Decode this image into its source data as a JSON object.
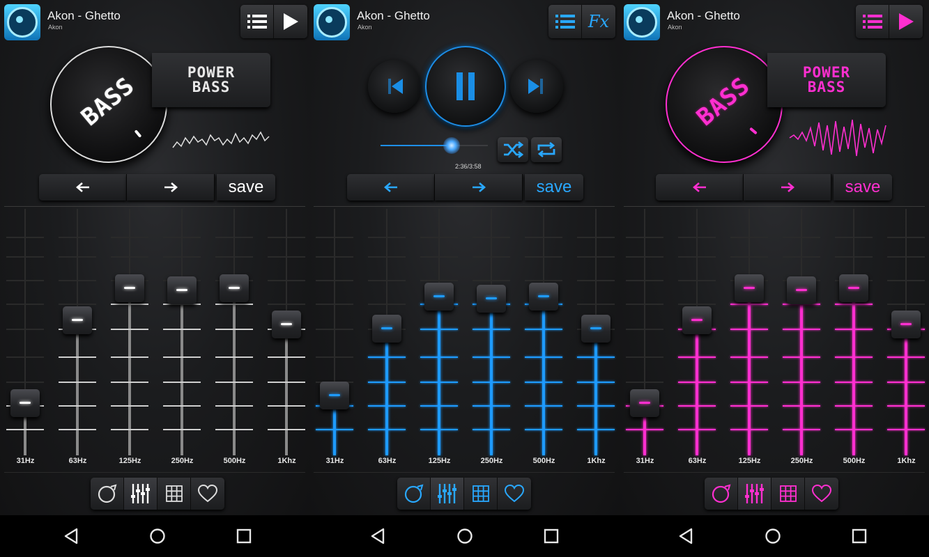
{
  "screens": [
    {
      "theme": "white",
      "accent": "#ffffff",
      "title": "Akon - Ghetto",
      "artist": "Akon",
      "header_buttons": [
        "list-icon",
        "play-icon"
      ],
      "knob_label": "BASS",
      "power_bass": [
        "POWER",
        "BASS"
      ],
      "save_label": "save",
      "bands": [
        {
          "label": "31Hz",
          "level": 0.23
        },
        {
          "label": "63Hz",
          "level": 0.64
        },
        {
          "label": "125Hz",
          "level": 0.8
        },
        {
          "label": "250Hz",
          "level": 0.79
        },
        {
          "label": "500Hz",
          "level": 0.8
        },
        {
          "label": "1Khz",
          "level": 0.62
        }
      ],
      "active_tab": 1
    },
    {
      "theme": "blue",
      "accent": "#1e9bff",
      "title": "Akon - Ghetto",
      "artist": "Akon",
      "header_buttons": [
        "list-icon",
        "fx-icon"
      ],
      "fx_label": "Fx",
      "seek_progress": 0.66,
      "time": "2:36/3:58",
      "save_label": "save",
      "bands": [
        {
          "label": "31Hz",
          "level": 0.27
        },
        {
          "label": "63Hz",
          "level": 0.6
        },
        {
          "label": "125Hz",
          "level": 0.76
        },
        {
          "label": "250Hz",
          "level": 0.75
        },
        {
          "label": "500Hz",
          "level": 0.76
        },
        {
          "label": "1Khz",
          "level": 0.6
        }
      ],
      "active_tab": 1
    },
    {
      "theme": "pink",
      "accent": "#ff2fd0",
      "title": "Akon - Ghetto",
      "artist": "Akon",
      "header_buttons": [
        "list-icon",
        "play-icon"
      ],
      "knob_label": "BASS",
      "power_bass": [
        "POWER",
        "BASS"
      ],
      "save_label": "save",
      "bands": [
        {
          "label": "31Hz",
          "level": 0.23
        },
        {
          "label": "63Hz",
          "level": 0.64
        },
        {
          "label": "125Hz",
          "level": 0.8
        },
        {
          "label": "250Hz",
          "level": 0.79
        },
        {
          "label": "500Hz",
          "level": 0.8
        },
        {
          "label": "1Khz",
          "level": 0.62
        }
      ],
      "active_tab": 1
    }
  ],
  "tab_icons": [
    "bass-knob-icon",
    "equalizer-icon",
    "grid-icon",
    "heart-icon"
  ],
  "nav_icons": [
    "back-icon",
    "home-icon",
    "recents-icon"
  ]
}
